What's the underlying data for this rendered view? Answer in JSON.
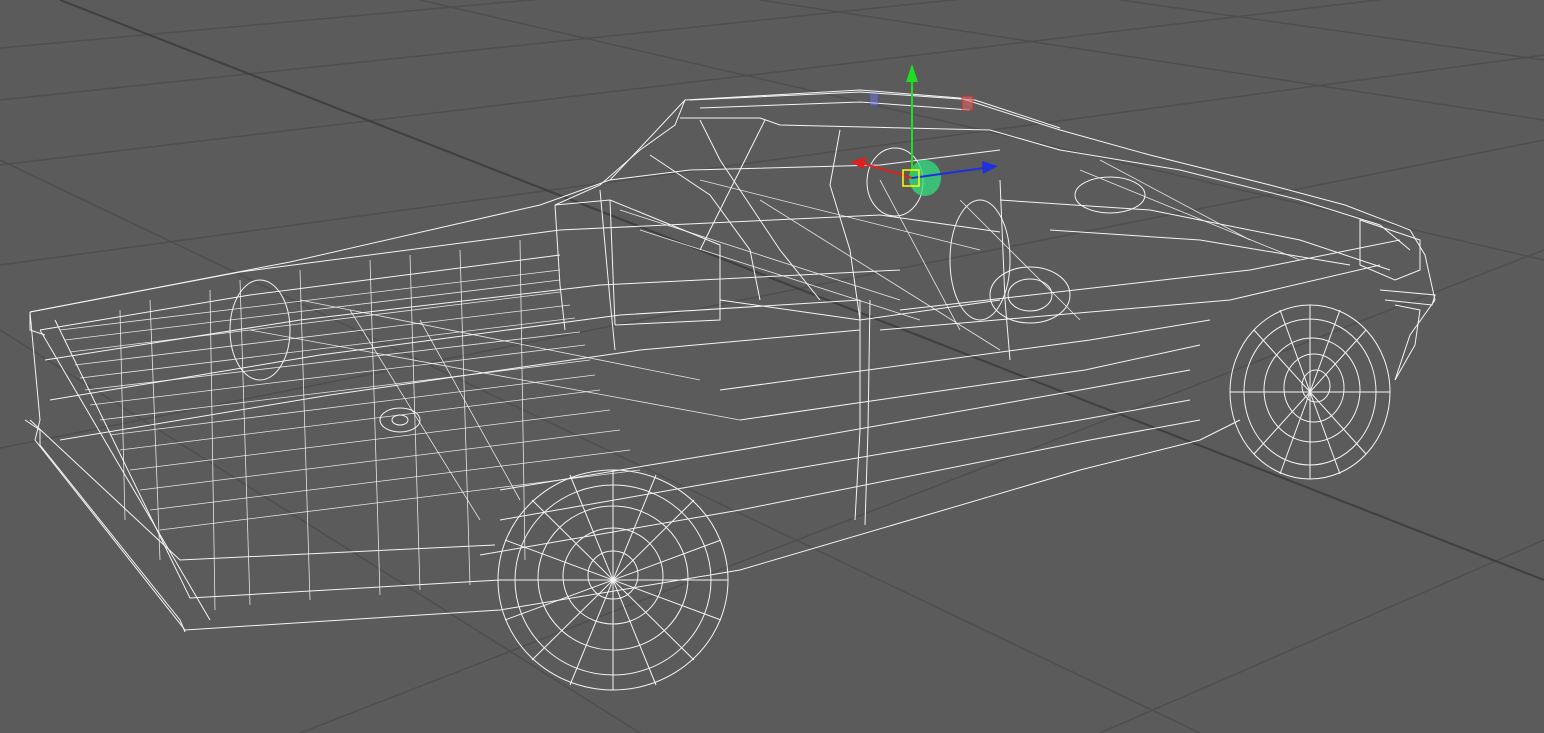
{
  "viewport": {
    "name": "3D viewport",
    "background": "#5b5b5b",
    "grid_color": "#4e4e4e",
    "wireframe_color": "#f4f4f4",
    "display_mode": "wireframe",
    "model": "car-wireframe"
  },
  "gizmo": {
    "type": "move-manipulator",
    "axis_colors": {
      "x": "#e02020",
      "y": "#22dd22",
      "z": "#2030e0"
    },
    "pivot_color": "#ffff00",
    "selection_color": "#30e080"
  }
}
